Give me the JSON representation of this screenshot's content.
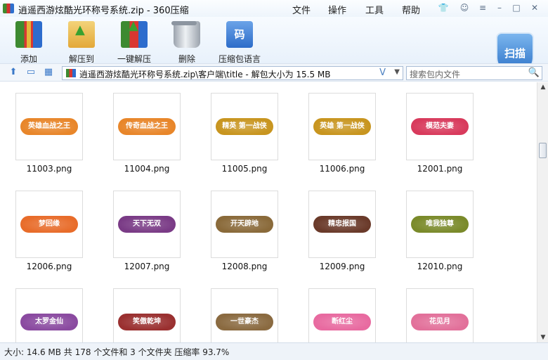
{
  "window": {
    "title": "逍遥西游炫酷光环称号系统.zip - 360压缩",
    "menu": [
      "文件",
      "操作",
      "工具",
      "帮助"
    ]
  },
  "toolbar": {
    "buttons": [
      {
        "label": "添加",
        "icon": "add-archive-icon"
      },
      {
        "label": "解压到",
        "icon": "extract-folder-icon"
      },
      {
        "label": "一键解压",
        "icon": "one-click-extract-icon"
      },
      {
        "label": "删除",
        "icon": "trash-can-icon"
      },
      {
        "label": "压缩包语言",
        "icon": "language-icon"
      }
    ],
    "scan_label": "扫描",
    "lang_glyph": "码"
  },
  "address": {
    "path": "逍遥西游炫酷光环称号系统.zip\\客户端\\title - 解包大小为 15.5 MB",
    "search_placeholder": "搜索包内文件"
  },
  "files": [
    {
      "name": "11003.png",
      "badge": "英雄血战之王",
      "color": "#e8862a"
    },
    {
      "name": "11004.png",
      "badge": "传奇血战之王",
      "color": "#e8862a"
    },
    {
      "name": "11005.png",
      "badge": "精英 第一战侠",
      "color": "#c8951f"
    },
    {
      "name": "11006.png",
      "badge": "英雄 第一战侠",
      "color": "#c8951f"
    },
    {
      "name": "12001.png",
      "badge": "模范夫妻",
      "color": "#d83a5c"
    },
    {
      "name": "12006.png",
      "badge": "梦回缘",
      "color": "#e86c2a"
    },
    {
      "name": "12007.png",
      "badge": "天下无双",
      "color": "#7a3b86"
    },
    {
      "name": "12008.png",
      "badge": "开天辟地",
      "color": "#8a6a3a"
    },
    {
      "name": "12009.png",
      "badge": "精忠报国",
      "color": "#6a3a2a"
    },
    {
      "name": "12010.png",
      "badge": "唯我独尊",
      "color": "#7a8a2a"
    },
    {
      "name": "",
      "badge": "太罗金仙",
      "color": "#8a4aa0"
    },
    {
      "name": "",
      "badge": "笑傲乾坤",
      "color": "#9a3030"
    },
    {
      "name": "",
      "badge": "一世豪杰",
      "color": "#8a6a40"
    },
    {
      "name": "",
      "badge": "断红尘",
      "color": "#e86aa0"
    },
    {
      "name": "",
      "badge": "花见月",
      "color": "#e2709a"
    }
  ],
  "status": {
    "text": "大小: 14.6 MB 共 178 个文件和 3 个文件夹 压缩率 93.7%"
  }
}
